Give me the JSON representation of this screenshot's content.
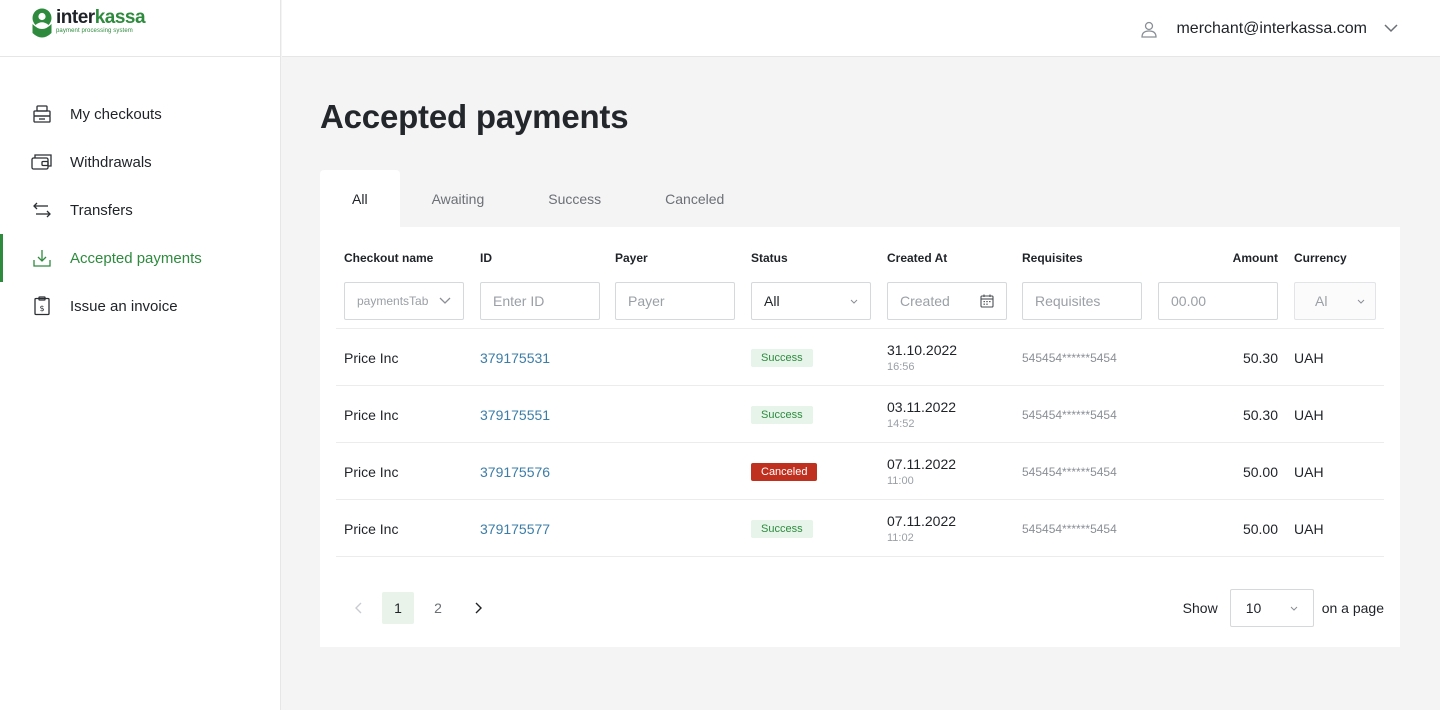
{
  "brand": {
    "name_part1": "inter",
    "name_part2": "kassa",
    "tagline": "payment processing system",
    "accent": "#2e8b3e"
  },
  "header": {
    "user_email": "merchant@interkassa.com"
  },
  "sidebar": {
    "items": [
      {
        "label": "My checkouts",
        "icon": "checkout-icon"
      },
      {
        "label": "Withdrawals",
        "icon": "wallet-icon"
      },
      {
        "label": "Transfers",
        "icon": "transfer-icon"
      },
      {
        "label": "Accepted payments",
        "icon": "download-icon",
        "active": true
      },
      {
        "label": "Issue an invoice",
        "icon": "invoice-icon"
      }
    ]
  },
  "page": {
    "title": "Accepted payments"
  },
  "tabs": [
    {
      "label": "All",
      "active": true
    },
    {
      "label": "Awaiting"
    },
    {
      "label": "Success"
    },
    {
      "label": "Canceled"
    }
  ],
  "table": {
    "columns": [
      "Checkout name",
      "ID",
      "Payer",
      "Status",
      "Created At",
      "Requisites",
      "Amount",
      "Currency"
    ],
    "filters": {
      "checkout_name": "paymentsTab",
      "id_placeholder": "Enter ID",
      "payer_placeholder": "Payer",
      "status": "All",
      "created_placeholder": "Created",
      "requisites_placeholder": "Requisites",
      "amount_placeholder": "00.00",
      "currency": "Al"
    },
    "rows": [
      {
        "checkout": "Price Inc",
        "id": "379175531",
        "status": "Success",
        "date": "31.10.2022",
        "time": "16:56",
        "requisites": "545454******5454",
        "amount": "50.30",
        "currency": "UAH"
      },
      {
        "checkout": "Price Inc",
        "id": "379175551",
        "status": "Success",
        "date": "03.11.2022",
        "time": "14:52",
        "requisites": "545454******5454",
        "amount": "50.30",
        "currency": "UAH"
      },
      {
        "checkout": "Price Inc",
        "id": "379175576",
        "status": "Canceled",
        "date": "07.11.2022",
        "time": "11:00",
        "requisites": "545454******5454",
        "amount": "50.00",
        "currency": "UAH"
      },
      {
        "checkout": "Price Inc",
        "id": "379175577",
        "status": "Success",
        "date": "07.11.2022",
        "time": "11:02",
        "requisites": "545454******5454",
        "amount": "50.00",
        "currency": "UAH"
      }
    ]
  },
  "pagination": {
    "pages": [
      "1",
      "2"
    ],
    "current": "1"
  },
  "page_size": {
    "show_label": "Show",
    "value": "10",
    "suffix": "on a page"
  },
  "colors": {
    "success_bg": "#e6f4ea",
    "success_text": "#2e8b3e",
    "canceled_bg": "#c0301f",
    "link": "#3c7da8"
  }
}
